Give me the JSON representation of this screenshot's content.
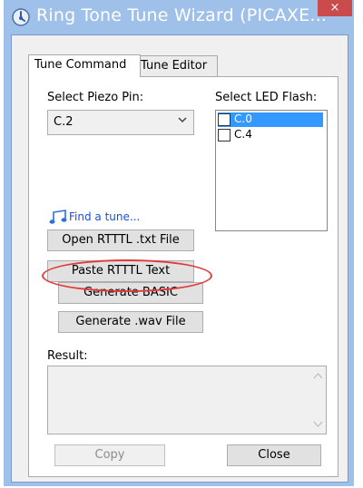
{
  "window": {
    "title": "Ring Tone Tune Wizard (PICAXE...",
    "close_symbol": "×",
    "app_icon": "ring-tone-app-icon"
  },
  "tabs": [
    {
      "label": "Tune Command",
      "active": true
    },
    {
      "label": "Tune Editor",
      "active": false
    }
  ],
  "piezo": {
    "label": "Select Piezo Pin:",
    "value": "C.2"
  },
  "led": {
    "label": "Select LED Flash:",
    "items": [
      {
        "label": "C.0",
        "selected": true,
        "checked": false
      },
      {
        "label": "C.4",
        "selected": false,
        "checked": false
      }
    ]
  },
  "find_tune": {
    "icon": "music-note-icon",
    "label": "Find a tune..."
  },
  "buttons": {
    "open_rtttl": "Open RTTTL .txt File",
    "paste_rtttl": "Paste RTTTL Text",
    "generate_basic": "Generate BASIC",
    "generate_wav": "Generate .wav File",
    "copy": "Copy",
    "close": "Close"
  },
  "result": {
    "label": "Result:",
    "value": ""
  },
  "colors": {
    "title_bar": "#9fc0e8",
    "highlight_ellipse": "#e03a3a",
    "selection": "#3399ff",
    "link": "#1a4fd6"
  }
}
